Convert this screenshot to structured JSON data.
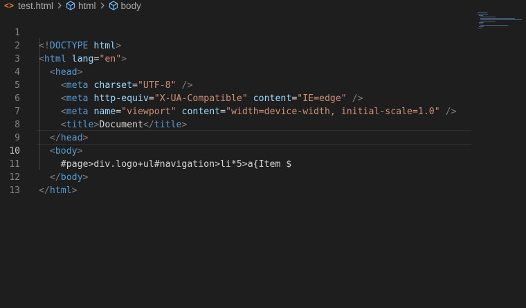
{
  "breadcrumb": {
    "file_icon": "html-file-icon",
    "file_name": "test.html",
    "items": [
      {
        "label": "html",
        "icon": "cube-icon"
      },
      {
        "label": "body",
        "icon": "cube-icon"
      }
    ]
  },
  "editor": {
    "language": "html",
    "current_line": 10,
    "lines": [
      {
        "number": "1",
        "text": "<!DOCTYPE html>"
      },
      {
        "number": "2",
        "text": "<html lang=\"en\">"
      },
      {
        "number": "3",
        "text": "  <head>"
      },
      {
        "number": "4",
        "text": "    <meta charset=\"UTF-8\" />"
      },
      {
        "number": "5",
        "text": "    <meta http-equiv=\"X-UA-Compatible\" content=\"IE=edge\" />"
      },
      {
        "number": "6",
        "text": "    <meta name=\"viewport\" content=\"width=device-width, initial-scale=1.0\" />"
      },
      {
        "number": "7",
        "text": "    <title>Document</title>"
      },
      {
        "number": "8",
        "text": "  </head>"
      },
      {
        "number": "9",
        "text": "  <body>"
      },
      {
        "number": "10",
        "text": "    #page>div.logo+ul#navigation>li*5>a{Item $"
      },
      {
        "number": "11",
        "text": "  </body>"
      },
      {
        "number": "12",
        "text": "</html>"
      },
      {
        "number": "13",
        "text": ""
      }
    ]
  },
  "colors": {
    "background": "#1e1e1e",
    "tag": "#569cd6",
    "attribute": "#9cdcfe",
    "string": "#ce9178",
    "text": "#d4d4d4",
    "bracket": "#808080",
    "line_number": "#858585"
  }
}
